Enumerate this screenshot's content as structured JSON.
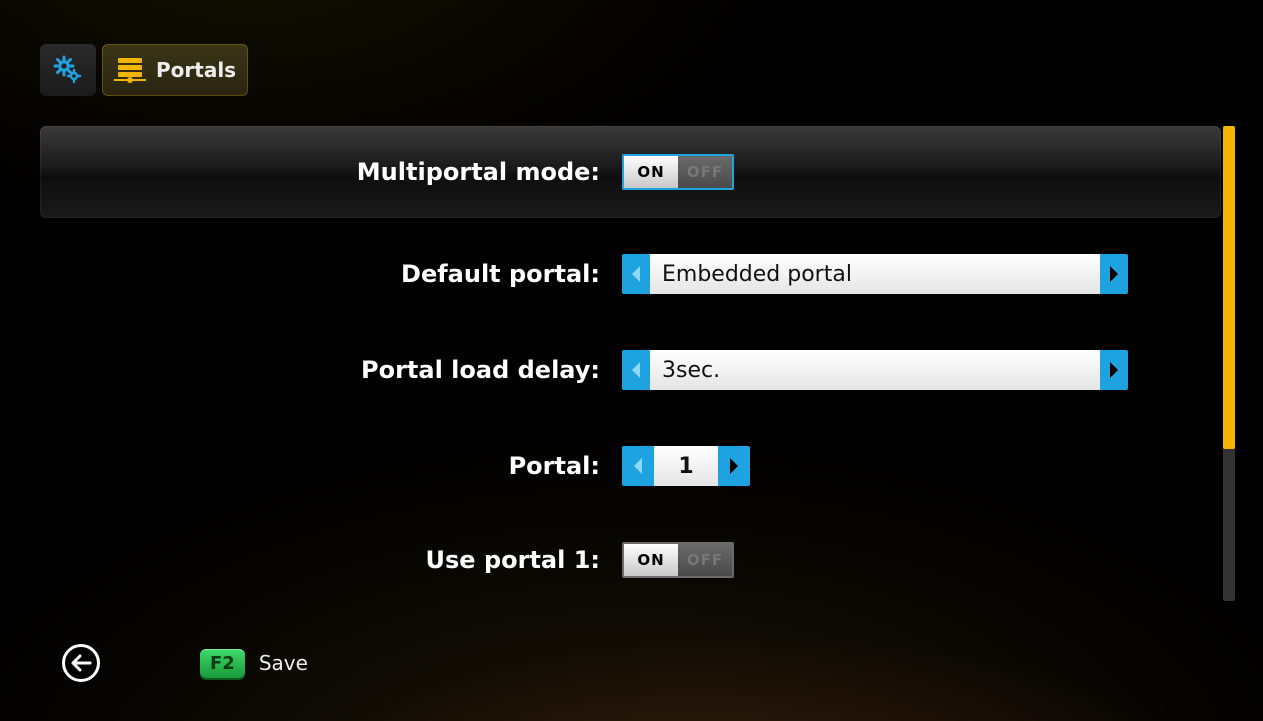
{
  "header": {
    "portals_label": "Portals"
  },
  "settings": {
    "multiportal": {
      "label": "Multiportal mode:",
      "on_text": "ON",
      "off_text": "OFF",
      "state": "on"
    },
    "default_portal": {
      "label": "Default portal:",
      "value": "Embedded portal"
    },
    "load_delay": {
      "label": "Portal load delay:",
      "value": "3sec."
    },
    "portal": {
      "label": "Portal:",
      "value": "1"
    },
    "use_portal1": {
      "label": "Use portal 1:",
      "on_text": "ON",
      "off_text": "OFF",
      "state": "on"
    }
  },
  "footer": {
    "fkey": "F2",
    "save_label": "Save"
  },
  "colors": {
    "accent_blue": "#1ea3e0",
    "accent_amber": "#f5b400",
    "fkey_green": "#1a9a3a"
  }
}
